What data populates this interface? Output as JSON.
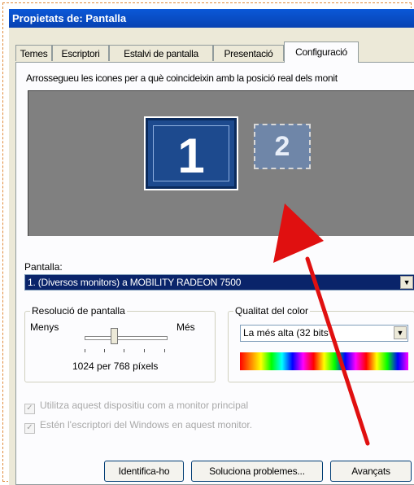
{
  "window": {
    "title": "Propietats de: Pantalla"
  },
  "tabs": [
    {
      "label": "Temes"
    },
    {
      "label": "Escriptori"
    },
    {
      "label": "Estalvi de pantalla"
    },
    {
      "label": "Presentació"
    },
    {
      "label": "Configuració",
      "active": true
    }
  ],
  "instruction": "Arrossegueu les icones per a què coincideixin amb la posició real dels monit",
  "monitors": [
    {
      "number": "1",
      "selected": true
    },
    {
      "number": "2",
      "selected": false
    }
  ],
  "display": {
    "label": "Pantalla:",
    "selected": "1. (Diversos monitors) a MOBILITY RADEON 7500"
  },
  "resolution": {
    "title": "Resolució de pantalla",
    "less": "Menys",
    "more": "Més",
    "value": "1024 per 768 píxels"
  },
  "color_quality": {
    "title": "Qualitat del color",
    "selected": "La més alta (32 bits"
  },
  "checkboxes": [
    {
      "label": "Utilitza aquest dispositiu com a monitor principal",
      "checked": true,
      "disabled": true
    },
    {
      "label": "Estén l'escriptori del Windows en aquest monitor.",
      "checked": true,
      "disabled": true
    }
  ],
  "buttons": {
    "identify": "Identifica-ho",
    "troubleshoot": "Soluciona problemes...",
    "advanced": "Avançats"
  },
  "colors": {
    "title_bar": "#0a58d8",
    "selection": "#0a246a",
    "annotation_arrow": "#e01010"
  }
}
